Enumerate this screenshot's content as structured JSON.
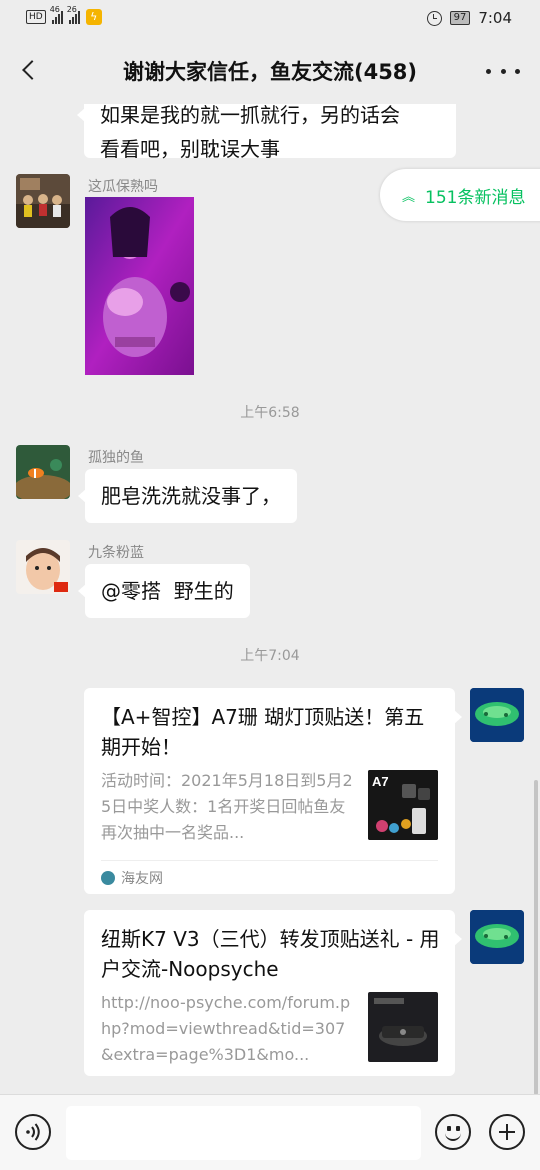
{
  "status_bar": {
    "left_chip": "HD",
    "signal1_label": "46",
    "signal2_label": "26",
    "battery": "97",
    "time": "7:04"
  },
  "header": {
    "back_icon": "chevron-left-icon",
    "title": "谢谢大家信任，鱼友交流(458)",
    "more_icon": "more-horizontal-icon"
  },
  "new_messages": {
    "label": "151条新消息",
    "icon": "double-chevron-up-icon"
  },
  "messages": [
    {
      "type": "text",
      "side": "left",
      "text_lines": [
        "如果是我的就一抓就行，另的话会",
        "看看吧，别耽误大事"
      ]
    },
    {
      "type": "image",
      "side": "left",
      "sender": "这瓜保熟吗"
    },
    {
      "type": "time",
      "text": "上午6:58"
    },
    {
      "type": "text",
      "side": "left",
      "sender": "孤独的鱼",
      "text": "肥皂洗洗就没事了，"
    },
    {
      "type": "text",
      "side": "left",
      "sender": "九条粉蓝",
      "text": "@零搭  野生的"
    },
    {
      "type": "time",
      "text": "上午7:04"
    },
    {
      "type": "link_card",
      "side": "right",
      "title": "【A+智控】A7珊 瑚灯顶贴送！第五期开始！",
      "description": "活动时间：2021年5月18日到5月25日中奖人数：1名开奖日回帖鱼友再次抽中一名奖品...",
      "thumbnail_label": "A7",
      "source": "海友网"
    },
    {
      "type": "link_card",
      "side": "right",
      "title": "纽斯K7 V3（三代）转发顶贴送礼 - 用户交流-Noopsyche",
      "description": "http://noo-psyche.com/forum.php?mod=viewthread&tid=307&extra=page%3D1&mo..."
    }
  ],
  "input_bar": {
    "voice_icon": "voice-icon",
    "emoji_icon": "emoji-icon",
    "plus_icon": "plus-icon"
  },
  "colors": {
    "background": "#ededed",
    "bubble": "#ffffff",
    "accent_green": "#07c160",
    "muted_text": "#999999"
  }
}
